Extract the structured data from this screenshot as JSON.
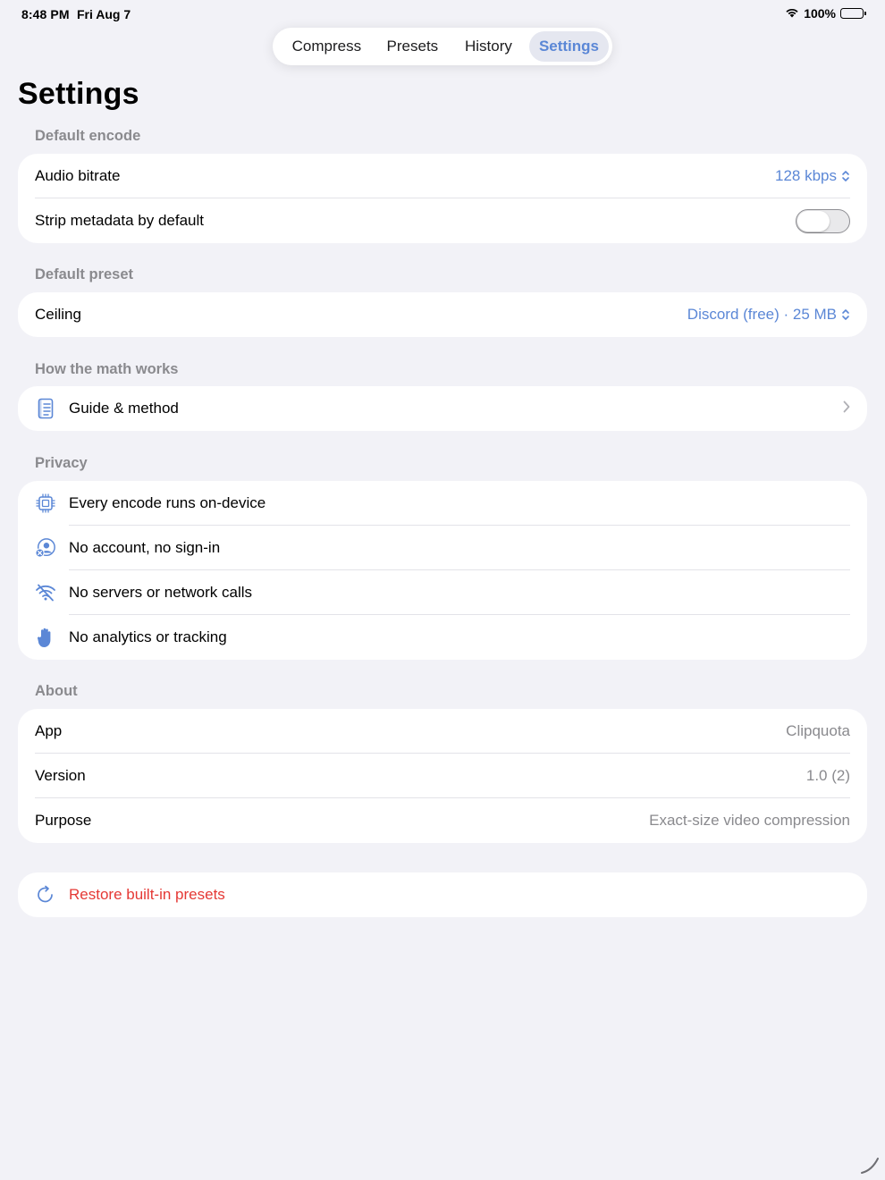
{
  "status_bar": {
    "time": "8:48 PM",
    "date": "Fri Aug 7",
    "battery": "100%"
  },
  "tabs": [
    {
      "label": "Compress",
      "active": false
    },
    {
      "label": "Presets",
      "active": false
    },
    {
      "label": "History",
      "active": false
    },
    {
      "label": "Settings",
      "active": true
    }
  ],
  "page_title": "Settings",
  "sections": {
    "default_encode": {
      "header": "Default encode",
      "audio_bitrate": {
        "label": "Audio bitrate",
        "value": "128 kbps"
      },
      "strip_metadata": {
        "label": "Strip metadata by default",
        "on": false
      }
    },
    "default_preset": {
      "header": "Default preset",
      "ceiling": {
        "label": "Ceiling",
        "value": "Discord (free) · 25 MB"
      }
    },
    "math": {
      "header": "How the math works",
      "guide": {
        "label": "Guide & method",
        "icon": "document-icon"
      }
    },
    "privacy": {
      "header": "Privacy",
      "items": [
        {
          "label": "Every encode runs on-device",
          "icon": "cpu-chip-icon"
        },
        {
          "label": "No account, no sign-in",
          "icon": "person-crossed-icon"
        },
        {
          "label": "No servers or network calls",
          "icon": "wifi-slash-icon"
        },
        {
          "label": "No analytics or tracking",
          "icon": "hand-raised-icon"
        }
      ]
    },
    "about": {
      "header": "About",
      "rows": [
        {
          "label": "App",
          "value": "Clipquota"
        },
        {
          "label": "Version",
          "value": "1.0 (2)"
        },
        {
          "label": "Purpose",
          "value": "Exact-size video compression"
        }
      ]
    },
    "restore": {
      "label": "Restore built-in presets",
      "icon": "arrow-clockwise-icon"
    }
  },
  "colors": {
    "accent": "#5B87D6",
    "destructive": "#E53935",
    "background": "#F2F2F7",
    "secondary_text": "#8A8A8E"
  }
}
